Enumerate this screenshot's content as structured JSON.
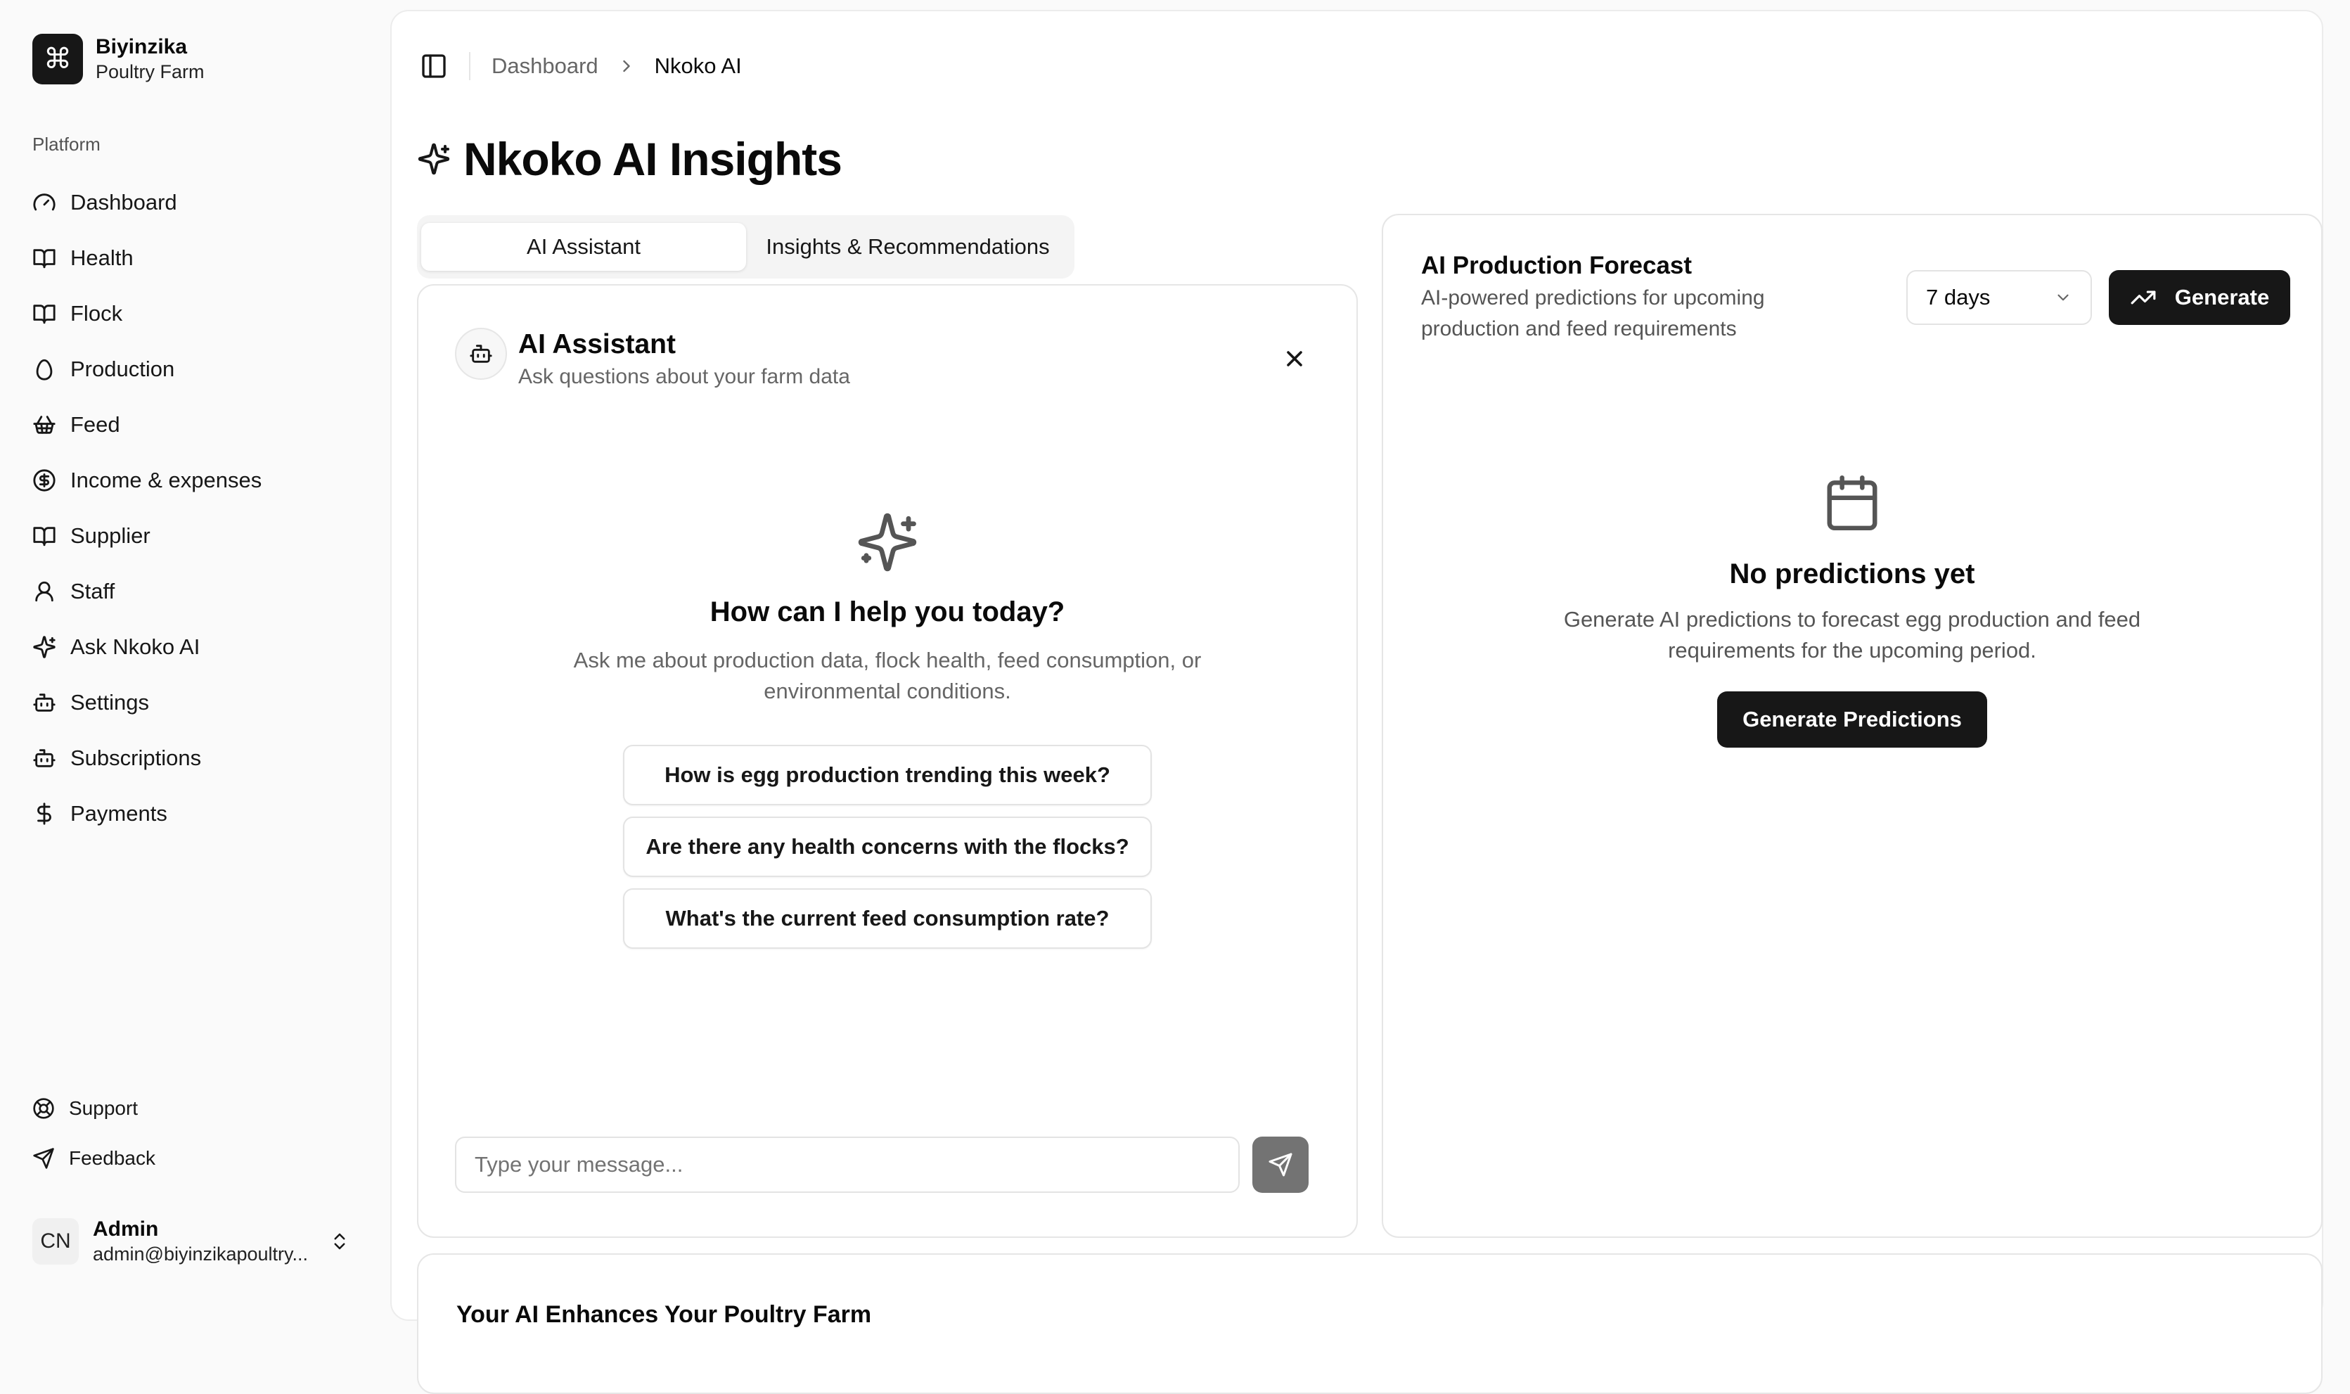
{
  "brand": {
    "name": "Biyinzika",
    "subtitle": "Poultry Farm",
    "logo_icon": "command-icon"
  },
  "sidebar": {
    "group_label": "Platform",
    "items": [
      {
        "label": "Dashboard",
        "icon": "gauge-icon"
      },
      {
        "label": "Health",
        "icon": "book-open-icon"
      },
      {
        "label": "Flock",
        "icon": "book-open-icon"
      },
      {
        "label": "Production",
        "icon": "egg-icon"
      },
      {
        "label": "Feed",
        "icon": "basket-icon"
      },
      {
        "label": "Income & expenses",
        "icon": "dollar-circle-icon"
      },
      {
        "label": "Supplier",
        "icon": "book-open-icon"
      },
      {
        "label": "Staff",
        "icon": "user-icon"
      },
      {
        "label": "Ask Nkoko AI",
        "icon": "sparkles-icon"
      },
      {
        "label": "Settings",
        "icon": "bot-icon"
      },
      {
        "label": "Subscriptions",
        "icon": "bot-icon"
      },
      {
        "label": "Payments",
        "icon": "dollar-icon"
      }
    ],
    "footer_items": [
      {
        "label": "Support",
        "icon": "life-buoy-icon"
      },
      {
        "label": "Feedback",
        "icon": "send-icon"
      }
    ]
  },
  "user": {
    "initials": "CN",
    "name": "Admin",
    "email": "admin@biyinzikapoultry..."
  },
  "breadcrumb": {
    "parent": "Dashboard",
    "current": "Nkoko AI"
  },
  "page": {
    "title": "Nkoko AI Insights"
  },
  "tabs": [
    {
      "label": "AI Assistant",
      "active": true
    },
    {
      "label": "Insights & Recommendations",
      "active": false
    }
  ],
  "assistant": {
    "title": "AI Assistant",
    "subtitle": "Ask questions about your farm data",
    "empty_title": "How can I help you today?",
    "empty_desc": "Ask me about production data, flock health, feed consumption, or environmental conditions.",
    "suggestions": [
      "How is egg production trending this week?",
      "Are there any health concerns with the flocks?",
      "What's the current feed consumption rate?"
    ],
    "input_placeholder": "Type your message..."
  },
  "forecast": {
    "title": "AI Production Forecast",
    "subtitle": "AI-powered predictions for upcoming production and feed requirements",
    "range_selected": "7 days",
    "generate_label": "Generate",
    "empty_title": "No predictions yet",
    "empty_desc": "Generate AI predictions to forecast egg production and feed requirements for the upcoming period.",
    "generate_predictions_label": "Generate Predictions"
  },
  "bottom_card": {
    "title": "Your AI Enhances Your Poultry Farm"
  },
  "colors": {
    "primary": "#171717",
    "muted_text": "#666666",
    "border": "#e5e5e5",
    "send_button": "#737373"
  }
}
